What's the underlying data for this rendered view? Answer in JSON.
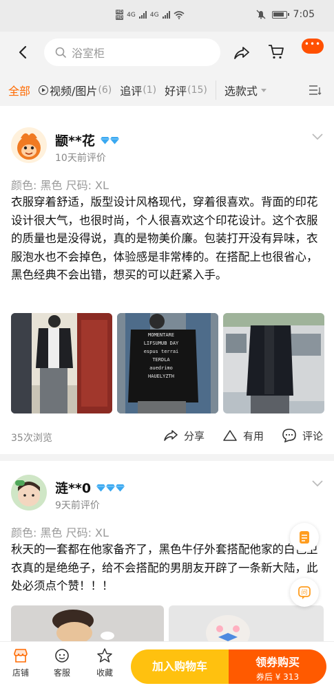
{
  "status_bar": {
    "time": "7:05",
    "hd_labels": [
      "HD",
      "HD"
    ],
    "net_labels": [
      "4G",
      "4G"
    ]
  },
  "header": {
    "search_placeholder": "浴室柜"
  },
  "filters": [
    {
      "label": "全部",
      "count": "",
      "active": true
    },
    {
      "label": "视频/图片",
      "count": "(6)",
      "icon": "play-icon"
    },
    {
      "label": "追评",
      "count": "(1)"
    },
    {
      "label": "好评",
      "count": "(15)"
    },
    {
      "label": "选款式",
      "dropdown": true
    }
  ],
  "reviews": [
    {
      "username": "颛**花",
      "level_diamonds": 2,
      "time": "10天前评价",
      "spec": "颜色: 黑色 尺码: XL",
      "text": "衣服穿着舒适，版型设计风格现代，穿着很喜欢。背面的印花设计很大气，也很时尚，个人很喜欢这个印花设计。这个衣服的质量也是没得说，真的是物美价廉。包装打开没有异味，衣服泡水也不会掉色，体验感是非常棒的。在搭配上也很省心，黑色经典不会出错，想买的可以赶紧入手。",
      "photo_back_text": [
        "MOMENTARE",
        "LIFSUMUB DAY",
        "espus terrai",
        "TERDLA",
        "auedrimo",
        "HAUELYZTH"
      ],
      "views": "35次浏览",
      "actions": {
        "share": "分享",
        "useful": "有用",
        "comment": "评论"
      }
    },
    {
      "username": "涟**0",
      "level_diamonds": 3,
      "time": "9天前评价",
      "spec": "颜色: 黑色 尺码: XL",
      "text": "秋天的一套都在他家备齐了，黑色牛仔外套搭配他家的白色卫衣真的是绝绝子，给不会搭配的男朋友开辟了一条新大陆，此处必须点个赞！！！"
    }
  ],
  "bottom_bar": {
    "store": "店铺",
    "service": "客服",
    "favorite": "收藏",
    "add_to_cart": "加入购物车",
    "buy": "领券购买",
    "buy_price": "券后 ¥ 313"
  },
  "colors": {
    "accent": "#ff5000",
    "cart_button": "#ffc10f",
    "diamond": "#3aa8f0"
  }
}
